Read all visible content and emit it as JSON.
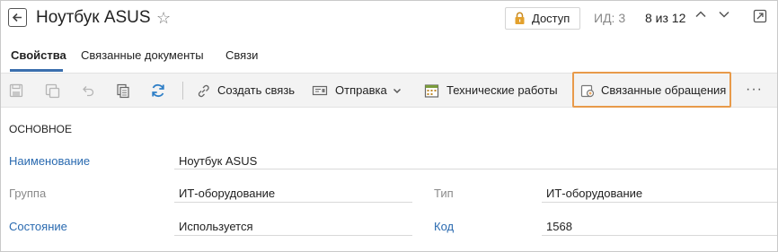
{
  "header": {
    "title": "Ноутбук ASUS",
    "access_label": "Доступ",
    "id_label": "ИД: 3",
    "counter": "8 из 12"
  },
  "tabs": [
    {
      "label": "Свойства",
      "active": true
    },
    {
      "label": "Связанные документы",
      "active": false
    },
    {
      "label": "Связи",
      "active": false
    }
  ],
  "toolbar": {
    "create_link": "Создать связь",
    "send": "Отправка",
    "tech_works": "Технические работы",
    "related_requests": "Связанные обращения"
  },
  "form": {
    "section_title": "ОСНОВНОЕ",
    "name_label": "Наименование",
    "name_value": "Ноутбук ASUS",
    "group_label": "Группа",
    "group_value": "ИТ-оборудование",
    "type_label": "Тип",
    "type_value": "ИТ-оборудование",
    "state_label": "Состояние",
    "state_value": "Используется",
    "code_label": "Код",
    "code_value": "1568"
  },
  "colors": {
    "accent": "#3b6fae",
    "link": "#2a6ab0",
    "highlight": "#e89a4a",
    "lock": "#e3a12d"
  }
}
